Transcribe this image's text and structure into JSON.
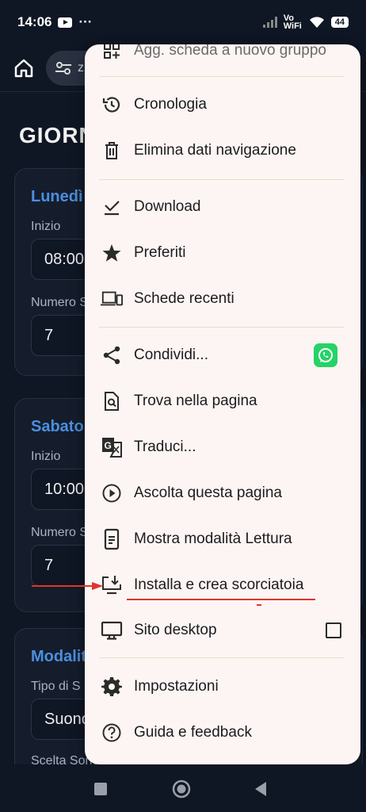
{
  "status_bar": {
    "time": "14:06",
    "dots": "···",
    "network": "Vo WiFi",
    "battery": "44"
  },
  "toolbar": {
    "url_text": "z"
  },
  "page": {
    "title": "GIORN",
    "cards": [
      {
        "title": "Lunedì",
        "start_label": "Inizio",
        "start_value": "08:00",
        "number_label": "Numero S",
        "number_value": "7"
      },
      {
        "title": "Sabato",
        "start_label": "Inizio",
        "start_value": "10:00",
        "number_label": "Numero S",
        "number_value": "7"
      },
      {
        "title": "Modalit",
        "type_label": "Tipo di S",
        "type_value": "Suono",
        "choice_label": "Scelta Sono"
      }
    ]
  },
  "menu": {
    "items": [
      {
        "label": "Agg. scheda a nuovo gruppo",
        "icon": "add-tab-group-icon"
      },
      {
        "label": "Cronologia",
        "icon": "history-icon"
      },
      {
        "label": "Elimina dati navigazione",
        "icon": "trash-icon"
      },
      {
        "label": "Download",
        "icon": "download-check-icon"
      },
      {
        "label": "Preferiti",
        "icon": "star-icon"
      },
      {
        "label": "Schede recenti",
        "icon": "devices-icon"
      },
      {
        "label": "Condividi...",
        "icon": "share-icon"
      },
      {
        "label": "Trova nella pagina",
        "icon": "find-in-page-icon"
      },
      {
        "label": "Traduci...",
        "icon": "translate-icon"
      },
      {
        "label": "Ascolta questa pagina",
        "icon": "play-circle-icon"
      },
      {
        "label": "Mostra modalità Lettura",
        "icon": "reader-mode-icon"
      },
      {
        "label": "Installa e crea scorciatoia",
        "icon": "install-app-icon"
      },
      {
        "label": "Sito desktop",
        "icon": "desktop-icon"
      },
      {
        "label": "Impostazioni",
        "icon": "gear-icon"
      },
      {
        "label": "Guida e feedback",
        "icon": "help-icon"
      }
    ]
  },
  "colors": {
    "accent": "#4b8fe0",
    "menu_bg": "#fcf5f3",
    "annotation": "#e0352b",
    "whatsapp": "#25d366"
  }
}
